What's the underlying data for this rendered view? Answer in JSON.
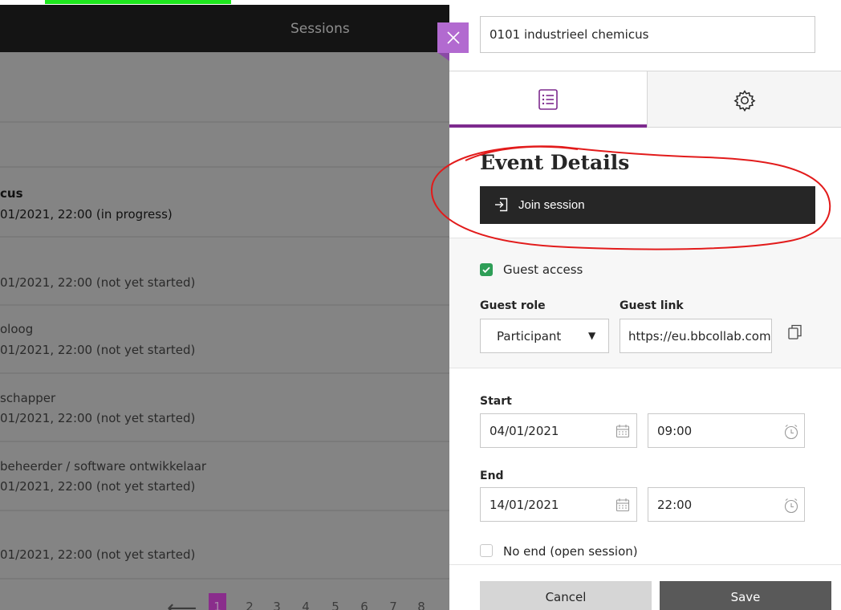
{
  "left_panel": {
    "header_title": "Sessions",
    "rows": [
      {
        "line1": "cus",
        "line2": "01/2021, 22:00 (in progress)"
      },
      {
        "line1": "",
        "line2": "01/2021, 22:00 (not yet started)"
      },
      {
        "line1": "oloog",
        "line2": "01/2021, 22:00 (not yet started)"
      },
      {
        "line1": "schapper",
        "line2": "01/2021, 22:00 (not yet started)"
      },
      {
        "line1": "beheerder / software ontwikkelaar",
        "line2": "01/2021, 22:00 (not yet started)"
      },
      {
        "line1": "",
        "line2": "01/2021, 22:00 (not yet started)"
      }
    ],
    "pager": {
      "pages": [
        "1",
        "2",
        "3",
        "4",
        "5",
        "6",
        "7",
        "8"
      ],
      "active_page": "1",
      "prev_icon": "arrow-left-icon"
    }
  },
  "close_icon": "close-icon",
  "session_name": "0101 industrieel chemicus",
  "tabs": [
    {
      "id": "details",
      "icon": "list-details-icon",
      "active": true
    },
    {
      "id": "settings",
      "icon": "gear-icon",
      "active": false
    }
  ],
  "section_title": "Event Details",
  "join_button": {
    "label": "Join session",
    "icon": "sign-in-icon"
  },
  "guest_access": {
    "checkbox_label": "Guest access",
    "checked": true,
    "role_label": "Guest role",
    "role_value": "Participant",
    "link_label": "Guest link",
    "link_value": "https://eu.bbcollab.com",
    "copy_icon": "copy-icon"
  },
  "start": {
    "label": "Start",
    "date": "04/01/2021",
    "time": "09:00"
  },
  "end": {
    "label": "End",
    "date": "14/01/2021",
    "time": "22:00"
  },
  "no_end": {
    "label": "No end (open session)",
    "checked": false
  },
  "footer": {
    "cancel": "Cancel",
    "save": "Save"
  },
  "colors": {
    "accent": "#7d2a8e",
    "checkbox": "#2e9e57",
    "close_tab": "#b26ad0",
    "annotation": "#e21b1b",
    "highlight": "#1fe81f"
  }
}
